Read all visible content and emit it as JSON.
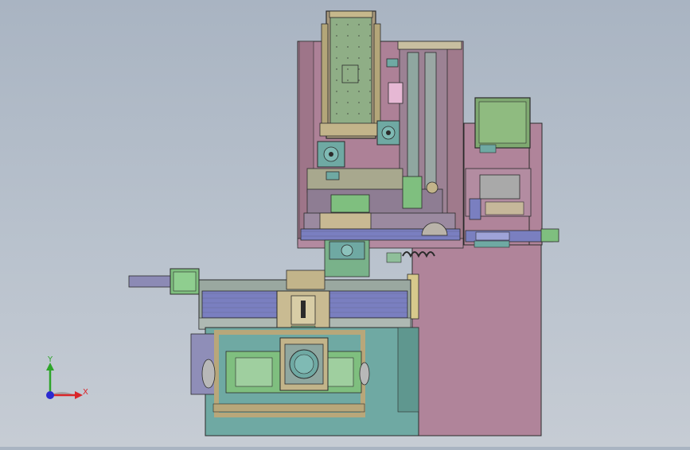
{
  "viewport": {
    "background_top": "#a9b4c2",
    "background_bottom": "#c6ccd4"
  },
  "triad": {
    "x_label": "X",
    "y_label": "Y",
    "x_color": "#d9262a",
    "y_color": "#2ea52a",
    "z_color": "#2a2ad0"
  },
  "palette": {
    "frame_mauve": "#b0849a",
    "base_teal": "#6fa9a3",
    "rail_blue": "#7a7fc0",
    "part_green": "#7fbf7f",
    "bracket_tan": "#b8a77a",
    "edge": "#2b2b2b"
  }
}
